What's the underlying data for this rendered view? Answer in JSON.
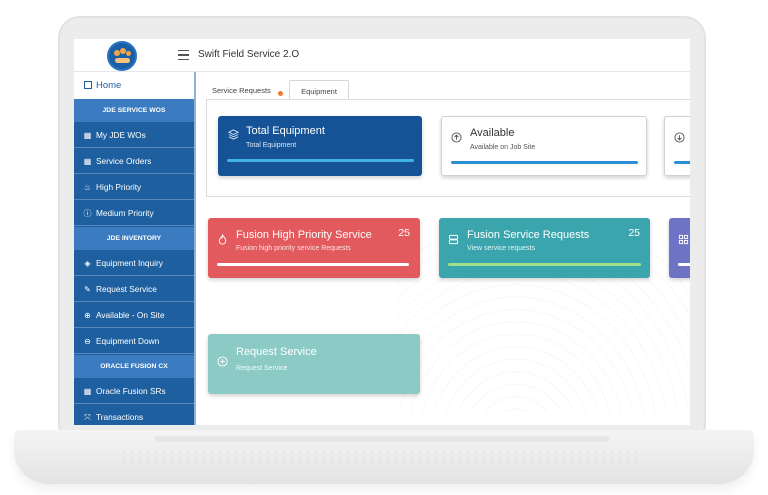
{
  "app": {
    "title": "Swift Field Service 2.O"
  },
  "sidebar": {
    "home_label": "Home",
    "sections": [
      {
        "header": "JDE SERVICE WOS",
        "items": [
          {
            "label": "My JDE WOs",
            "icon": "grid-icon"
          },
          {
            "label": "Service Orders",
            "icon": "grid-icon"
          },
          {
            "label": "High Priority",
            "icon": "flame-icon"
          },
          {
            "label": "Medium Priority",
            "icon": "info-icon"
          }
        ]
      },
      {
        "header": "JDE INVENTORY",
        "items": [
          {
            "label": "Equipment Inquiry",
            "icon": "layers-icon"
          },
          {
            "label": "Request Service",
            "icon": "pencil-icon"
          },
          {
            "label": "Available - On Site",
            "icon": "arrow-up-circle-icon"
          },
          {
            "label": "Equipment Down",
            "icon": "arrow-down-circle-icon"
          }
        ]
      },
      {
        "header": "ORACLE FUSION CX",
        "items": [
          {
            "label": "Oracle Fusion SRs",
            "icon": "grid-icon"
          },
          {
            "label": "Transactions",
            "icon": "transactions-icon"
          }
        ]
      }
    ]
  },
  "tabs": [
    {
      "label": "Service Requests",
      "active": false
    },
    {
      "label": "Equipment",
      "active": true
    }
  ],
  "cards": {
    "total_equipment": {
      "title": "Total Equipment",
      "subtitle": "Total Equipment",
      "color": "#155396",
      "bar_color": "#3fb3e8"
    },
    "available": {
      "title": "Available",
      "subtitle": "Available on Job Site",
      "color": "#ffffff",
      "bar_color": "#2a8fd4"
    },
    "fusion_high_priority": {
      "title": "Fusion High Priority Service",
      "subtitle": "Fusion high priority service Requests",
      "count": "25",
      "color": "#e35a5e"
    },
    "fusion_service_requests": {
      "title": "Fusion Service Requests",
      "subtitle": "View service requests",
      "count": "25",
      "color": "#3aa5ad",
      "bar_color": "#9fe08a"
    },
    "request_service": {
      "title": "Request Service",
      "subtitle": "Request Service",
      "color": "#8ccac6"
    }
  }
}
